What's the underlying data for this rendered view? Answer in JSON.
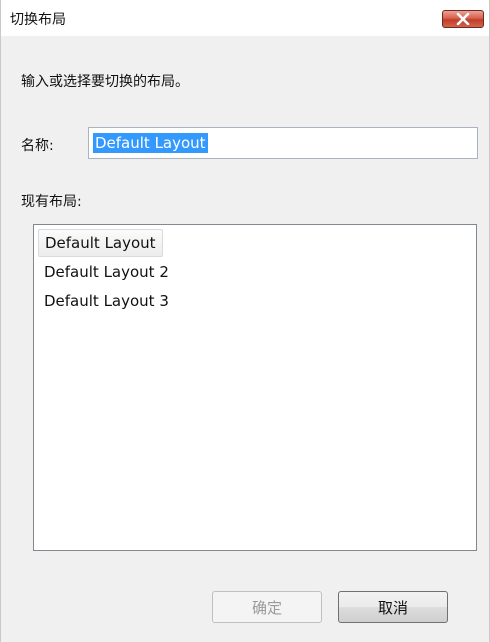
{
  "window": {
    "title": "切换布局"
  },
  "dialog": {
    "prompt": "输入或选择要切换的布局。",
    "name_label": "名称:",
    "name_value": "Default Layout",
    "list_label": "现有布局:",
    "layouts": [
      "Default Layout",
      "Default Layout 2",
      "Default Layout 3"
    ],
    "selected_index": 0
  },
  "buttons": {
    "ok_label": "确定",
    "ok_enabled": false,
    "cancel_label": "取消"
  },
  "colors": {
    "selection_highlight": "#3399ff",
    "close_button": "#c94a36"
  },
  "icons": {
    "close": "close-x-icon"
  }
}
